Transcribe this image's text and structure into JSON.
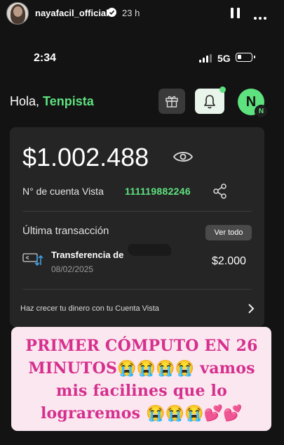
{
  "story": {
    "username": "nayafacil_official",
    "time_ago": "23 h"
  },
  "phone": {
    "status_time": "2:34",
    "network": "5G"
  },
  "app": {
    "greeting_prefix": "Hola, ",
    "user_name": "Tenpista",
    "profile_initial": "N",
    "profile_badge": "N",
    "accent_color": "#5ee27f",
    "balance": "$1.002.488",
    "account_label": "N° de cuenta Vista",
    "account_number": "111119882246",
    "last_transaction_title": "Última transacción",
    "see_all_label": "Ver todo",
    "transaction": {
      "title": "Transferencia de",
      "date": "08/02/2025",
      "amount": "$2.000"
    },
    "promo_text": "Haz crecer tu dinero con tu Cuenta Vista"
  },
  "caption": {
    "text": "PRIMER CÓMPUTO EN 26 MINUTOS😭😭😭😭 vamos mis facilines que lo lograremos 😭😭😭💕💕",
    "color": "#d62f8e",
    "background": "#fbe7ef"
  }
}
